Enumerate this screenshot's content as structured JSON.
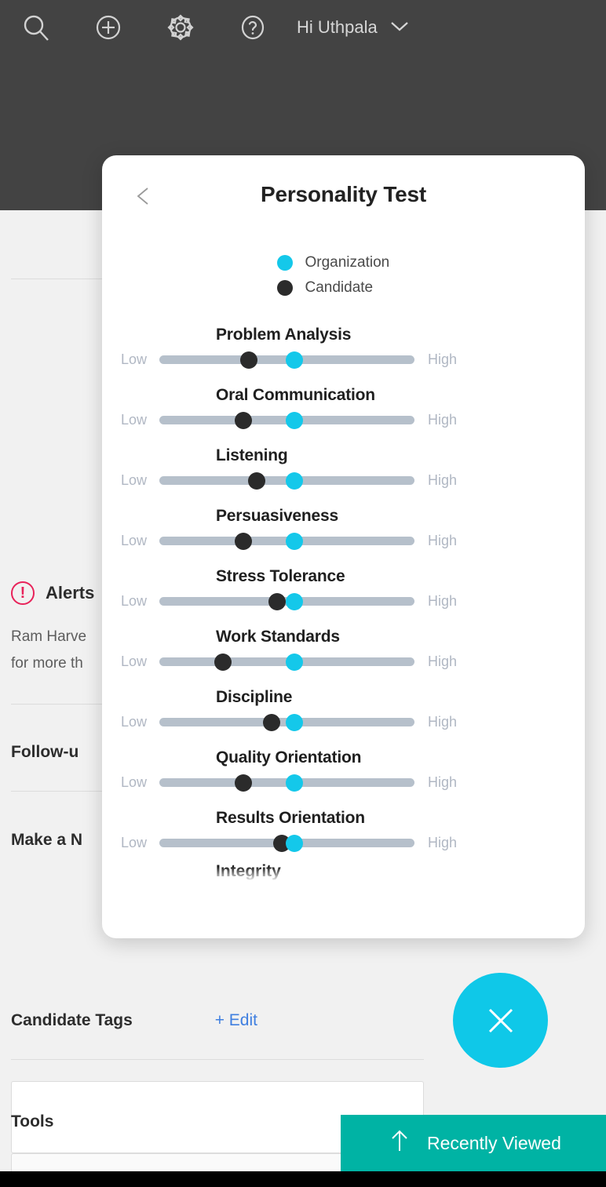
{
  "topbar": {
    "icons": [
      {
        "name": "search-icon",
        "label": "Search"
      },
      {
        "name": "add-icon",
        "label": "Add"
      },
      {
        "name": "settings-gear-icon",
        "label": "Settings"
      },
      {
        "name": "help-question-icon",
        "label": "Help"
      }
    ],
    "greeting": "Hi Uthpala",
    "chevron": "chevron-down-icon",
    "background_color": "#434343"
  },
  "background_page": {
    "alerts": {
      "title": "Alerts",
      "icon": "alert-exclamation-icon",
      "line1": "Ram Harve",
      "line2": "for more th"
    },
    "followup_title": "Follow-u",
    "make_note_title": "Make a N",
    "candidate_tags_title": "Candidate Tags",
    "edit_link": "+ Edit",
    "tools_title": "Tools"
  },
  "modal": {
    "title": "Personality Test",
    "back_icon": "back-chevron-icon",
    "legend": [
      {
        "label": "Organization",
        "color": "#14c8ea"
      },
      {
        "label": "Candidate",
        "color": "#2b2b2b"
      }
    ],
    "scale_low": "Low",
    "scale_high": "High",
    "partial_next_trait": "Integrity"
  },
  "chart_data": {
    "type": "bar",
    "title": "Personality Test",
    "xlabel": "",
    "ylabel": "",
    "xlim": [
      0,
      100
    ],
    "grid": false,
    "legend_position": "top-center",
    "categories": [
      "Problem Analysis",
      "Oral Communication",
      "Listening",
      "Persuasiveness",
      "Stress Tolerance",
      "Work Standards",
      "Discipline",
      "Quality Orientation",
      "Results Orientation"
    ],
    "tick_labels": [
      "Low",
      "High"
    ],
    "series": [
      {
        "name": "Candidate",
        "color": "#2b2b2b",
        "values": [
          35,
          33,
          38,
          33,
          46,
          25,
          44,
          33,
          48
        ]
      },
      {
        "name": "Organization",
        "color": "#14c8ea",
        "values": [
          53,
          53,
          53,
          53,
          53,
          53,
          53,
          53,
          53
        ]
      }
    ]
  },
  "fab": {
    "icon": "close-x-icon",
    "color": "#0fc8e8"
  },
  "recently_viewed": {
    "label": "Recently Viewed",
    "icon": "arrow-up-icon",
    "color": "#00b3a4"
  }
}
